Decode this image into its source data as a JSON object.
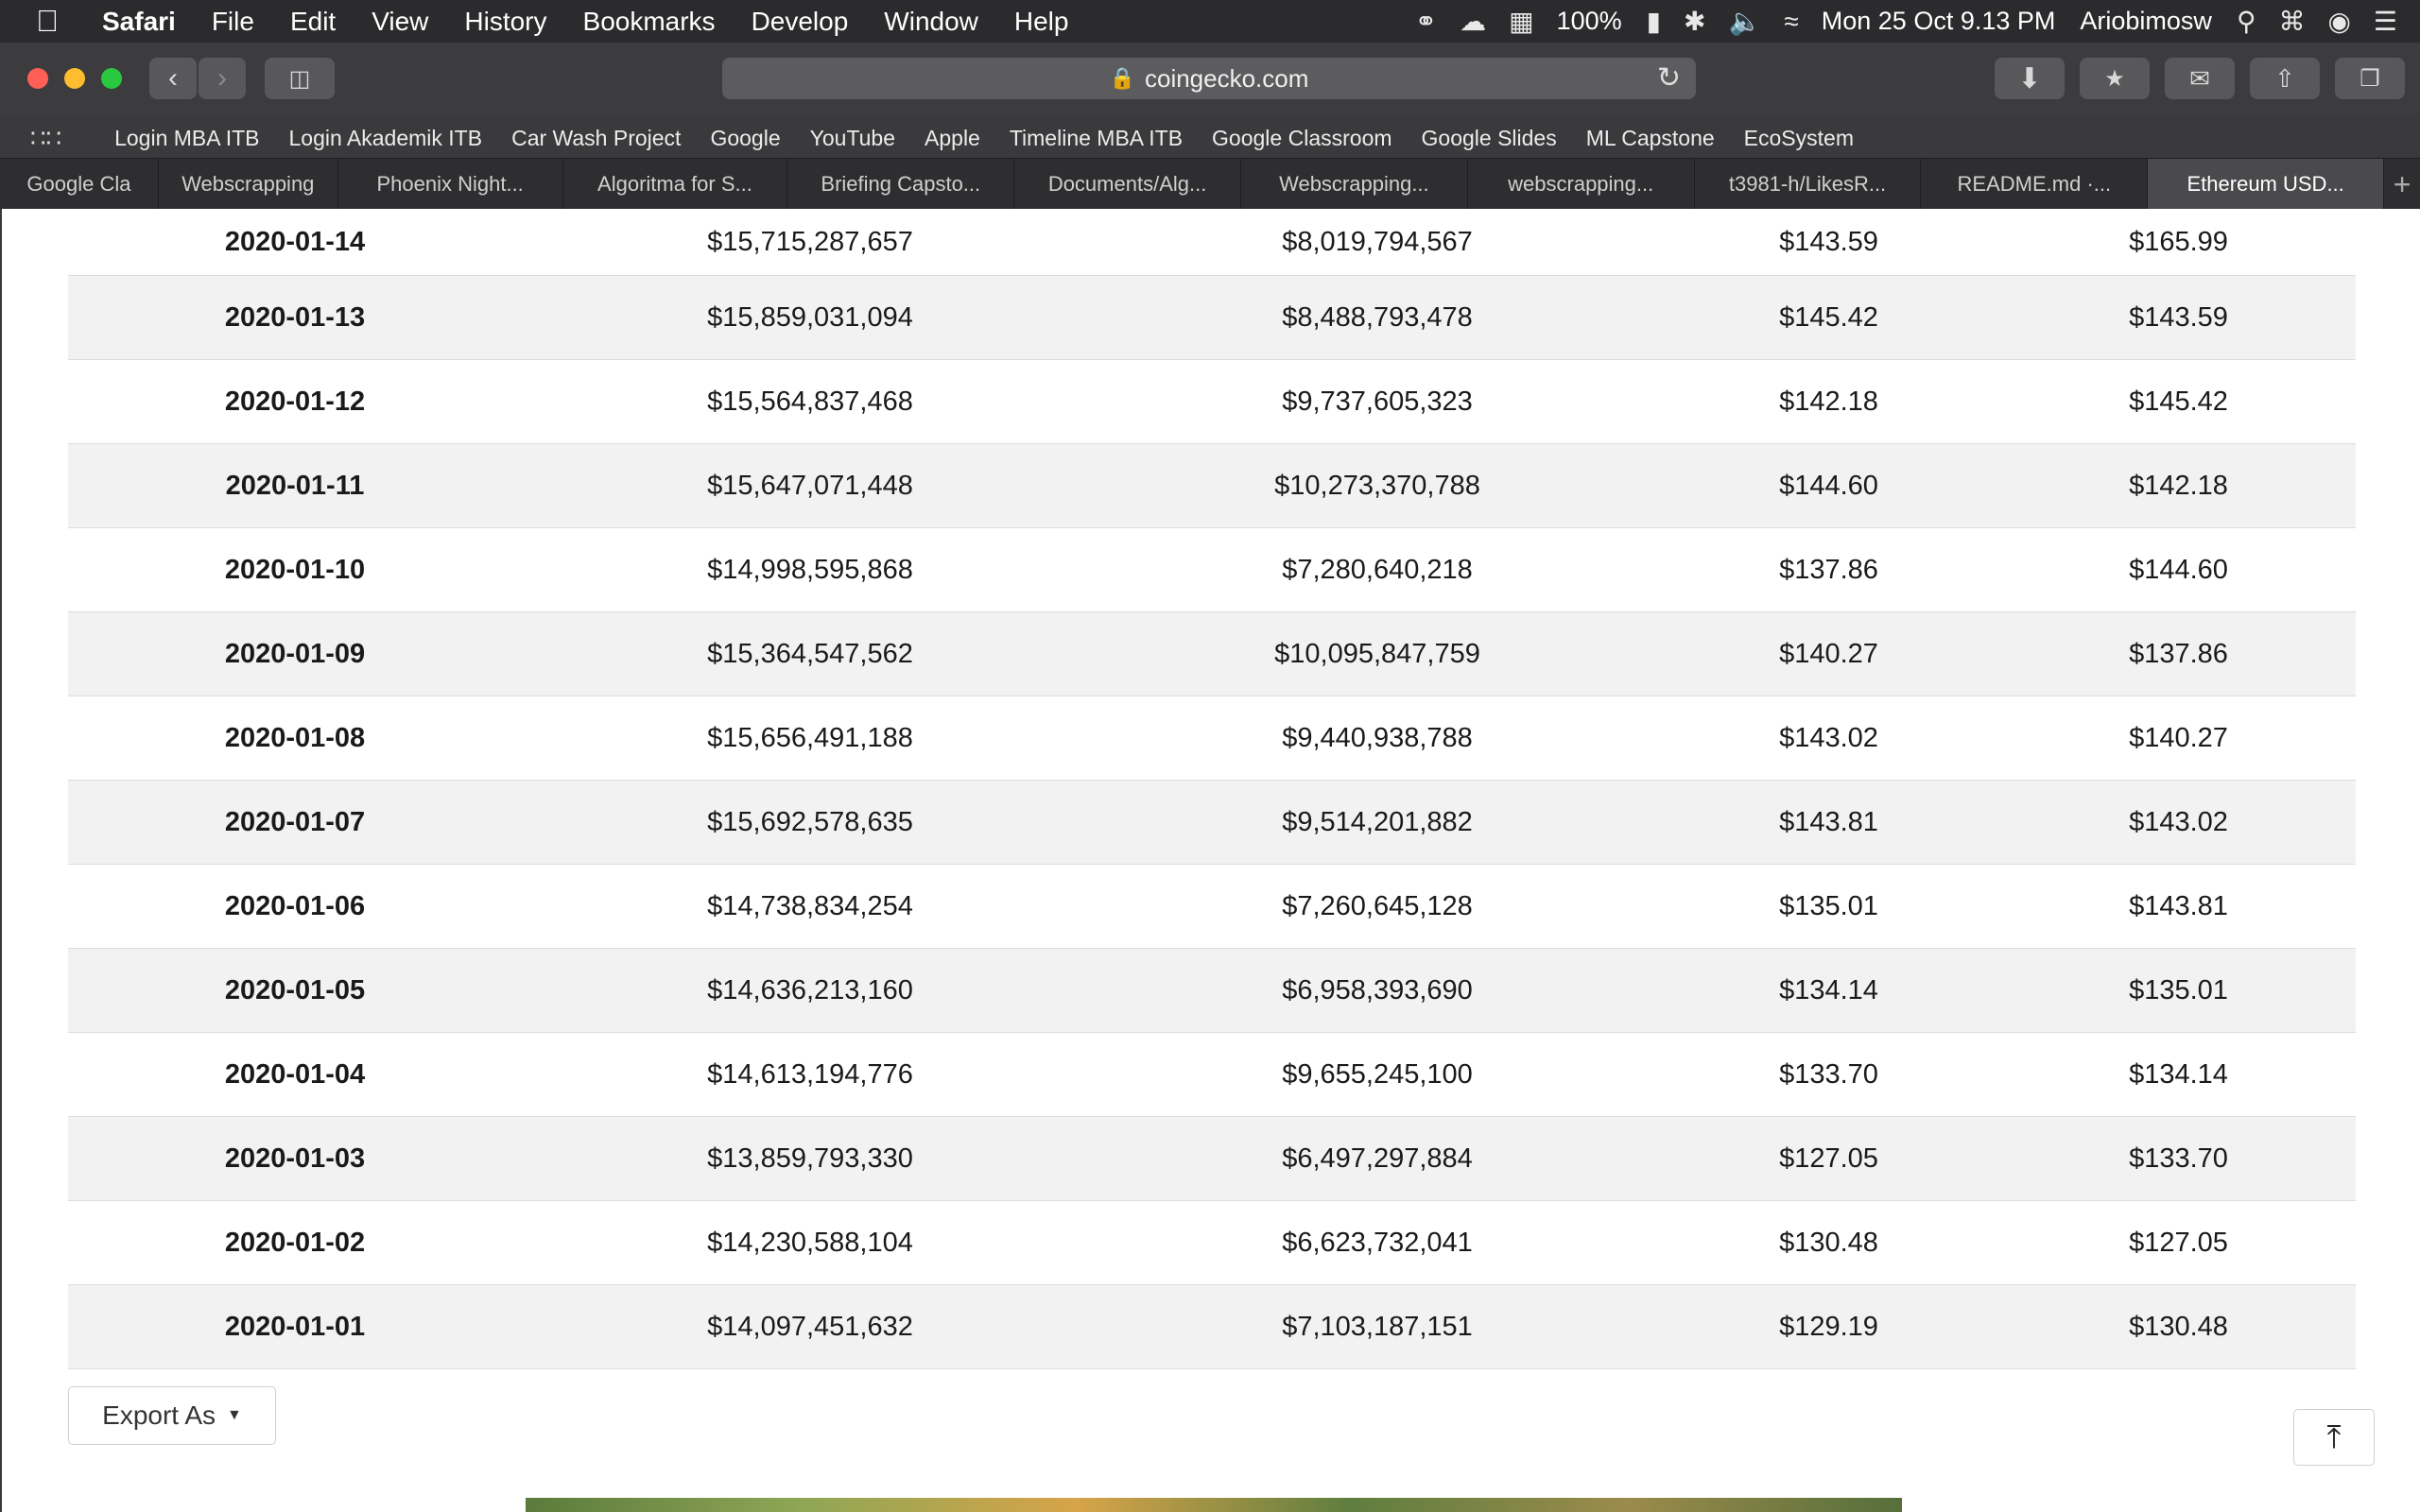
{
  "menubar": {
    "app": "Safari",
    "items": [
      "File",
      "Edit",
      "View",
      "History",
      "Bookmarks",
      "Develop",
      "Window",
      "Help"
    ],
    "battery": "100%",
    "datetime": "Mon 25 Oct  9.13 PM",
    "user": "Ariobimosw"
  },
  "toolbar": {
    "url": "coingecko.com"
  },
  "bookmarks": [
    "Login MBA ITB",
    "Login Akademik ITB",
    "Car Wash Project",
    "Google",
    "YouTube",
    "Apple",
    "Timeline MBA ITB",
    "Google Classroom",
    "Google Slides",
    "ML Capstone",
    "EcoSystem"
  ],
  "tabs": [
    {
      "label": "Google Cla"
    },
    {
      "label": "Webscrapping"
    },
    {
      "label": "Phoenix Night..."
    },
    {
      "label": "Algoritma for S..."
    },
    {
      "label": "Briefing Capsto..."
    },
    {
      "label": "Documents/Alg..."
    },
    {
      "label": "Webscrapping..."
    },
    {
      "label": "webscrapping..."
    },
    {
      "label": "t3981-h/LikesR..."
    },
    {
      "label": "README.md ·..."
    },
    {
      "label": "Ethereum USD..."
    }
  ],
  "table": {
    "rows": [
      {
        "date": "2020-01-14",
        "market_cap": "$15,715,287,657",
        "volume": "$8,019,794,567",
        "open": "$143.59",
        "close": "$165.99"
      },
      {
        "date": "2020-01-13",
        "market_cap": "$15,859,031,094",
        "volume": "$8,488,793,478",
        "open": "$145.42",
        "close": "$143.59"
      },
      {
        "date": "2020-01-12",
        "market_cap": "$15,564,837,468",
        "volume": "$9,737,605,323",
        "open": "$142.18",
        "close": "$145.42"
      },
      {
        "date": "2020-01-11",
        "market_cap": "$15,647,071,448",
        "volume": "$10,273,370,788",
        "open": "$144.60",
        "close": "$142.18"
      },
      {
        "date": "2020-01-10",
        "market_cap": "$14,998,595,868",
        "volume": "$7,280,640,218",
        "open": "$137.86",
        "close": "$144.60"
      },
      {
        "date": "2020-01-09",
        "market_cap": "$15,364,547,562",
        "volume": "$10,095,847,759",
        "open": "$140.27",
        "close": "$137.86"
      },
      {
        "date": "2020-01-08",
        "market_cap": "$15,656,491,188",
        "volume": "$9,440,938,788",
        "open": "$143.02",
        "close": "$140.27"
      },
      {
        "date": "2020-01-07",
        "market_cap": "$15,692,578,635",
        "volume": "$9,514,201,882",
        "open": "$143.81",
        "close": "$143.02"
      },
      {
        "date": "2020-01-06",
        "market_cap": "$14,738,834,254",
        "volume": "$7,260,645,128",
        "open": "$135.01",
        "close": "$143.81"
      },
      {
        "date": "2020-01-05",
        "market_cap": "$14,636,213,160",
        "volume": "$6,958,393,690",
        "open": "$134.14",
        "close": "$135.01"
      },
      {
        "date": "2020-01-04",
        "market_cap": "$14,613,194,776",
        "volume": "$9,655,245,100",
        "open": "$133.70",
        "close": "$134.14"
      },
      {
        "date": "2020-01-03",
        "market_cap": "$13,859,793,330",
        "volume": "$6,497,297,884",
        "open": "$127.05",
        "close": "$133.70"
      },
      {
        "date": "2020-01-02",
        "market_cap": "$14,230,588,104",
        "volume": "$6,623,732,041",
        "open": "$130.48",
        "close": "$127.05"
      },
      {
        "date": "2020-01-01",
        "market_cap": "$14,097,451,632",
        "volume": "$7,103,187,151",
        "open": "$129.19",
        "close": "$130.48"
      }
    ]
  },
  "export": {
    "label": "Export As"
  },
  "icons": {
    "scroll_top": "arrow-to-top-icon",
    "apple": "apple-logo-icon"
  },
  "colors": {
    "row_shade": "#f2f2f2",
    "toolbar": "#3c3c3e"
  }
}
